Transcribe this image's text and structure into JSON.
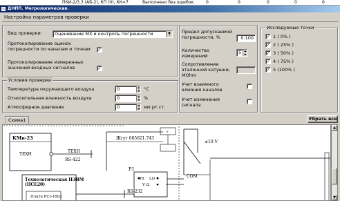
{
  "background_row": {
    "device": "ПКИ-2/3.3 (АБ-2), КП (0), КК=7",
    "status": "Выполнено без ошибок.",
    "values": [
      "0",
      "0",
      "0",
      "0",
      "0"
    ]
  },
  "window": {
    "title": "ДНПП. Метрологическая."
  },
  "header": {
    "title": "Настройка параметров проверки"
  },
  "left": {
    "type_label": "Вид проверки:",
    "type_value": "Оценивание МХ и контроль погрешности",
    "log_estimates_label": "Протоколирование оценок погрешности по каналам и точкам",
    "log_estimates_checked": "✓",
    "log_measured_label": "Протоколирование измеренных значений входных сигналов",
    "log_measured_checked": "✓"
  },
  "conditions": {
    "title": "Условия проверки",
    "rows": [
      {
        "label": "Температура окружающего воздуха",
        "value": "0",
        "unit": "°C"
      },
      {
        "label": "Относительная влажность воздуха",
        "value": "0",
        "unit": "%"
      },
      {
        "label": "Атмосферное давление",
        "value": "0",
        "unit": "мм рт.ст."
      }
    ]
  },
  "middle": {
    "limit_label": "Предел допускаемой погрешности, %",
    "limit_value": "0.100",
    "count_label": "Количество измерений",
    "count_value": "5",
    "resistance_label": "Сопротивление эталонной катушки, MOhm",
    "resistance_value": "",
    "mutual_label": "Учет взаимного влияния каналов",
    "change_label": "Учет изменения сигнала"
  },
  "points": {
    "title": "Исследуемые точки",
    "items": [
      {
        "label": "1 ( 0% )",
        "check": "✓"
      },
      {
        "label": "2 ( 25% )",
        "check": "✓"
      },
      {
        "label": "3 ( 50% )",
        "check": "✓"
      },
      {
        "label": "4 ( 75% )",
        "check": "✓"
      },
      {
        "label": "5 (100% )",
        "check": "✓"
      }
    ]
  },
  "tabs": {
    "scheme": "Схема1",
    "hide_all": "Убрать все"
  },
  "diagram": {
    "kmn": "КМн-23",
    "tekhn_left": "ТЕХН",
    "tekhn_right": "ТЕХН",
    "rs422": "RS-422",
    "cable": "Жгут 685621.743",
    "tech_pc_line1": "Технологическая ПЭВМ",
    "tech_pc_line2": "(ПСЕ20)",
    "board": "Плата PCI-1602",
    "p1": "P1",
    "rs232": "RS-232",
    "hi": "HI",
    "lo": "LO",
    "vomega": "V Ω",
    "com": "COM",
    "ten_v": "±10 V",
    "plus": "+",
    "minus": "-"
  }
}
